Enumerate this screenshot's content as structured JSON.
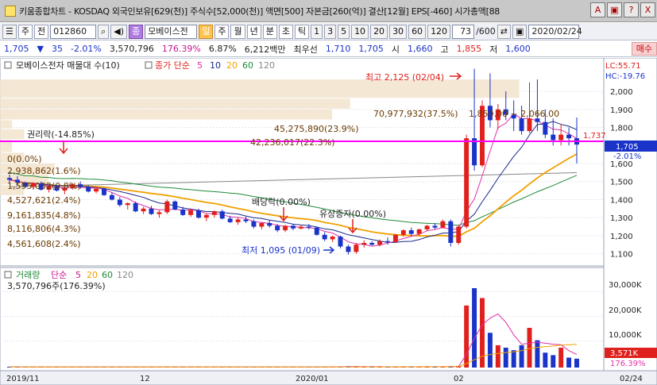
{
  "window": {
    "title": "키움종합차트 - KOSDAQ 외국인보유[629(천)] 주식수[52,000(천)] 액면[500] 자본금[260(억)] 결산[12월] EPS[-460] 시가총액[88",
    "controls": [
      "A",
      "▣",
      "?",
      "X"
    ]
  },
  "toolbar": {
    "market_label": "주",
    "prev_label": "전",
    "code": "012860",
    "stock_badge": "종",
    "stock_name": "모베이스전",
    "period_buttons": [
      "일",
      "주",
      "월",
      "년",
      "분",
      "초",
      "틱"
    ],
    "interval_buttons": [
      "1",
      "3",
      "5",
      "10",
      "20",
      "30",
      "60",
      "120"
    ],
    "count": "73",
    "count_total": "/600",
    "date": "2020/02/24"
  },
  "quote": {
    "price": "1,705",
    "change": "35",
    "change_pct": "-2.01%",
    "volume": "3,570,796",
    "vol_ratio": "176.39%",
    "turnover": "6.87%",
    "amount": "6,212백만",
    "pref_label": "최우선",
    "ask": "1,710",
    "bid": "1,705",
    "open_label": "시",
    "open": "1,660",
    "high_label": "고",
    "high": "1,855",
    "low_label": "저",
    "low": "1,600",
    "buy_button": "매수"
  },
  "price_panel": {
    "legend_title": "모베이스전자 매물대 수(10)",
    "ma_label": "종가 단순",
    "ma_periods": [
      "5",
      "10",
      "20",
      "60",
      "120"
    ],
    "lc_label": "LC:55.71",
    "hc_label": "HC:-19.76",
    "current_price_tag": "1,705",
    "current_change_tag": "-2.01%",
    "ref_line_value": "1,737",
    "max_label": "최고 2,125 (02/04)",
    "min_label": "최저 1,095 (01/09)",
    "event_labels": [
      "권리락(-14.85%)",
      "배당락(0.00%)",
      "유상증자(0.00%)"
    ],
    "volume_profile_labels": [
      "70,977,932(37.5%)",
      "45,275,890(23.9%)",
      "42,236,017(22.3%)",
      "0(0.0%)",
      "2,938,862(1.6%)",
      "1,595,032(0.8%)",
      "4,527,621(2.4%)",
      "9,161,835(4.8%)",
      "8,116,806(4.3%)",
      "4,561,608(2.4%)"
    ],
    "range_label": "1,850.00 ~ 2,066.00",
    "y_ticks": [
      "2,000",
      "1,900",
      "1,800",
      "1,705",
      "1,600",
      "1,500",
      "1,400",
      "1,300",
      "1,200",
      "1,100"
    ]
  },
  "volume_panel": {
    "legend_title": "거래량",
    "ma_label": "단순",
    "ma_periods": [
      "5",
      "20",
      "60",
      "120"
    ],
    "volume_text": "3,570,796주(176.39%)",
    "y_ticks": [
      "30,000K",
      "20,000K",
      "10,000K"
    ],
    "current_tag": "3,571K",
    "current_pct": "176.39%"
  },
  "x_axis": [
    "2019/11",
    "12",
    "2020/01",
    "02",
    "02/24"
  ],
  "chart_data": {
    "type": "candlestick",
    "title": "모베이스전자",
    "ylim": [
      1050,
      2150
    ],
    "candles": [
      [
        1520,
        1540,
        1490,
        1510
      ],
      [
        1510,
        1530,
        1480,
        1495
      ],
      [
        1495,
        1500,
        1465,
        1470
      ],
      [
        1470,
        1495,
        1460,
        1490
      ],
      [
        1490,
        1500,
        1450,
        1455
      ],
      [
        1455,
        1480,
        1440,
        1475
      ],
      [
        1475,
        1480,
        1445,
        1450
      ],
      [
        1450,
        1470,
        1430,
        1465
      ],
      [
        1465,
        1490,
        1455,
        1485
      ],
      [
        1485,
        1500,
        1460,
        1470
      ],
      [
        1470,
        1480,
        1440,
        1445
      ],
      [
        1445,
        1470,
        1435,
        1460
      ],
      [
        1460,
        1465,
        1420,
        1425
      ],
      [
        1425,
        1440,
        1395,
        1400
      ],
      [
        1400,
        1415,
        1360,
        1370
      ],
      [
        1370,
        1385,
        1345,
        1380
      ],
      [
        1380,
        1390,
        1330,
        1335
      ],
      [
        1335,
        1360,
        1320,
        1350
      ],
      [
        1350,
        1365,
        1315,
        1320
      ],
      [
        1320,
        1340,
        1300,
        1330
      ],
      [
        1330,
        1400,
        1320,
        1390
      ],
      [
        1390,
        1395,
        1340,
        1345
      ],
      [
        1345,
        1360,
        1310,
        1315
      ],
      [
        1315,
        1350,
        1305,
        1340
      ],
      [
        1340,
        1350,
        1295,
        1300
      ],
      [
        1300,
        1325,
        1280,
        1315
      ],
      [
        1315,
        1340,
        1300,
        1335
      ],
      [
        1335,
        1345,
        1290,
        1295
      ],
      [
        1295,
        1310,
        1270,
        1275
      ],
      [
        1275,
        1300,
        1260,
        1290
      ],
      [
        1290,
        1305,
        1270,
        1280
      ],
      [
        1280,
        1290,
        1240,
        1250
      ],
      [
        1250,
        1275,
        1235,
        1270
      ],
      [
        1270,
        1285,
        1245,
        1255
      ],
      [
        1255,
        1265,
        1220,
        1230
      ],
      [
        1230,
        1260,
        1220,
        1255
      ],
      [
        1255,
        1265,
        1230,
        1240
      ],
      [
        1240,
        1260,
        1235,
        1250
      ],
      [
        1250,
        1265,
        1235,
        1245
      ],
      [
        1245,
        1250,
        1200,
        1205
      ],
      [
        1205,
        1220,
        1170,
        1180
      ],
      [
        1180,
        1200,
        1165,
        1195
      ],
      [
        1195,
        1200,
        1130,
        1140
      ],
      [
        1140,
        1150,
        1095,
        1110
      ],
      [
        1110,
        1160,
        1100,
        1150
      ],
      [
        1150,
        1175,
        1135,
        1160
      ],
      [
        1160,
        1170,
        1145,
        1150
      ],
      [
        1150,
        1180,
        1140,
        1170
      ],
      [
        1170,
        1190,
        1150,
        1165
      ],
      [
        1165,
        1210,
        1160,
        1205
      ],
      [
        1205,
        1235,
        1195,
        1230
      ],
      [
        1230,
        1245,
        1200,
        1210
      ],
      [
        1210,
        1240,
        1200,
        1235
      ],
      [
        1235,
        1260,
        1225,
        1255
      ],
      [
        1255,
        1270,
        1235,
        1245
      ],
      [
        1245,
        1290,
        1240,
        1280
      ],
      [
        1280,
        1290,
        1140,
        1160
      ],
      [
        1160,
        1260,
        1150,
        1250
      ],
      [
        1250,
        1760,
        1240,
        1740
      ],
      [
        1740,
        2125,
        1560,
        1590
      ],
      [
        1590,
        1950,
        1580,
        1920
      ],
      [
        1920,
        2100,
        1800,
        1840
      ],
      [
        1840,
        1930,
        1790,
        1900
      ],
      [
        1900,
        2000,
        1840,
        1870
      ],
      [
        1870,
        1950,
        1780,
        1850
      ],
      [
        1850,
        1920,
        1760,
        1780
      ],
      [
        1780,
        2050,
        1770,
        1850
      ],
      [
        1850,
        2066,
        1780,
        1830
      ],
      [
        1830,
        1900,
        1740,
        1760
      ],
      [
        1760,
        1850,
        1700,
        1730
      ],
      [
        1730,
        1820,
        1700,
        1760
      ],
      [
        1760,
        1800,
        1700,
        1740
      ],
      [
        1740,
        1855,
        1600,
        1705
      ]
    ],
    "volume_k": [
      300,
      250,
      200,
      220,
      260,
      200,
      180,
      240,
      260,
      210,
      190,
      200,
      220,
      260,
      300,
      250,
      230,
      240,
      220,
      210,
      380,
      260,
      230,
      240,
      220,
      250,
      260,
      230,
      280,
      240,
      210,
      260,
      230,
      220,
      250,
      240,
      210,
      230,
      240,
      280,
      320,
      260,
      400,
      520,
      350,
      280,
      240,
      300,
      280,
      320,
      380,
      300,
      340,
      360,
      300,
      420,
      520,
      600,
      25000,
      32000,
      28000,
      14000,
      9000,
      8000,
      7000,
      9000,
      16000,
      11000,
      6000,
      5000,
      8000,
      4000,
      3571
    ]
  },
  "colors": {
    "up": "#e0201c",
    "down": "#1a33c8",
    "ref_line": "#ff00ff",
    "ma5": "#e030a8",
    "ma10": "#1a2a8a",
    "ma20": "#f0a000",
    "ma60": "#1f8a3a",
    "ma120": "#888888"
  }
}
